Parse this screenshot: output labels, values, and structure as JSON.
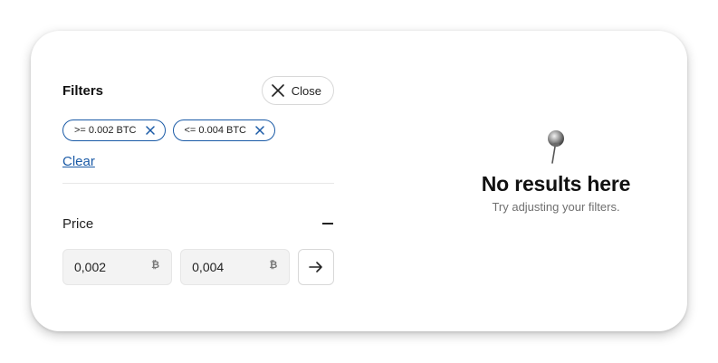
{
  "filters": {
    "title": "Filters",
    "close_label": "Close",
    "chips": [
      {
        "label": ">= 0.002 BTC"
      },
      {
        "label": "<= 0.004 BTC"
      }
    ],
    "clear_label": "Clear"
  },
  "price": {
    "title": "Price",
    "min_value": "0,002",
    "max_value": "0,004",
    "currency_symbol": "₿"
  },
  "empty_state": {
    "title": "No results here",
    "subtitle": "Try adjusting your filters."
  },
  "icons": {
    "close": "close-icon",
    "chip_remove": "x-icon",
    "collapse": "minus-icon",
    "submit": "arrow-right-icon",
    "empty": "pushpin-icon"
  },
  "colors": {
    "accent": "#1a5aa6",
    "field_bg": "#f3f3f3",
    "text": "#111111",
    "muted": "#6f6f6f"
  }
}
